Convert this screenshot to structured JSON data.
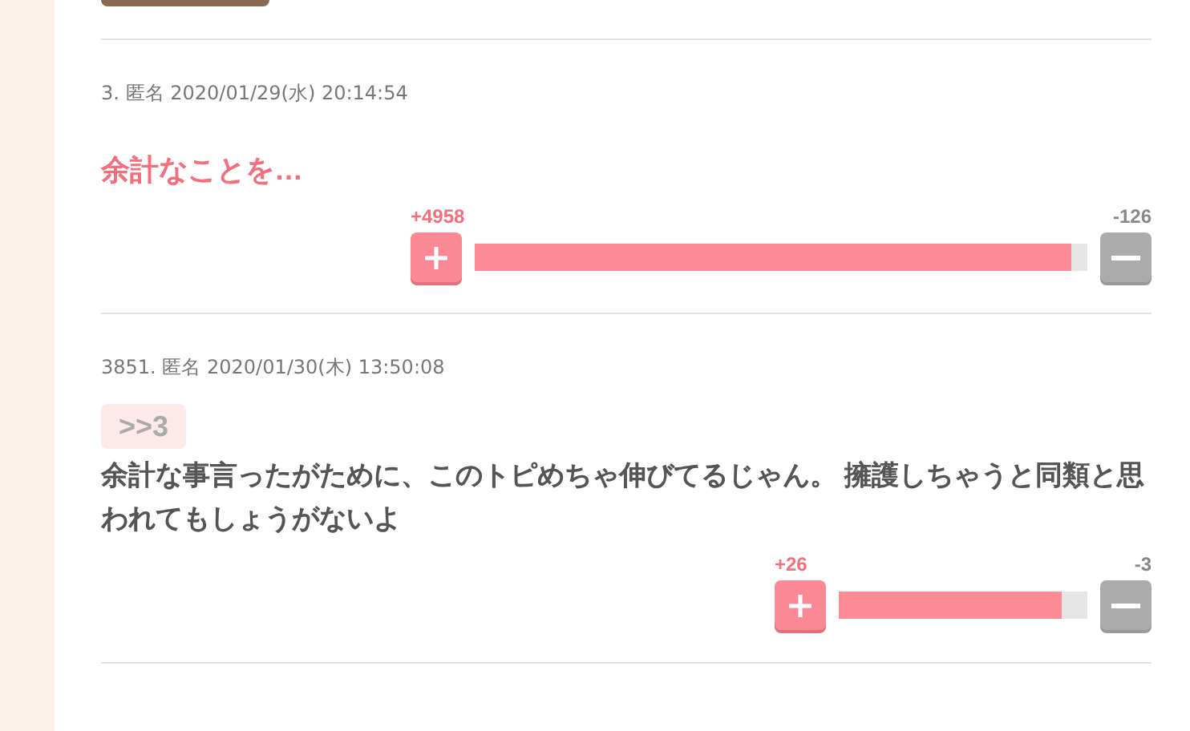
{
  "comments": [
    {
      "number": "3.",
      "author": "匿名",
      "date": "2020/01/29(水) 20:14:54",
      "kind": "title",
      "text": "余計なことを…",
      "plus": "+4958",
      "minus": "-126",
      "level": 0.975
    },
    {
      "number": "3851.",
      "author": "匿名",
      "date": "2020/01/30(木) 13:50:08",
      "kind": "reply",
      "anchor": ">>3",
      "text": "余計な事言ったがために、このトピめちゃ伸びてるじゃん。 擁護しちゃうと同類と思われてもしょうがないよ",
      "plus": "+26",
      "minus": "-3",
      "level": 0.897
    }
  ]
}
